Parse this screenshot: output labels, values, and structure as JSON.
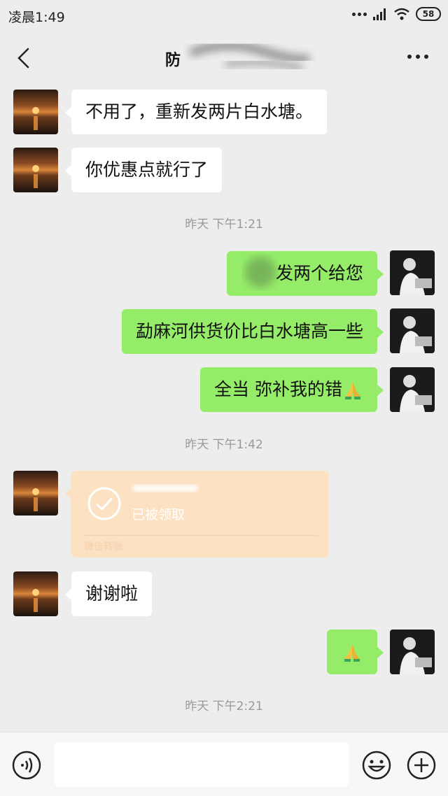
{
  "status": {
    "time": "凌晨1:49",
    "battery": "58"
  },
  "header": {
    "title": "防"
  },
  "messages": {
    "m1": "不用了，重新发两片白水塘。",
    "m2": "你优惠点就行了",
    "ts1": "昨天 下午1:21",
    "m3": "发两个给您",
    "m4": "勐麻河供货价比白水塘高一些",
    "m5": "全当 弥补我的错",
    "ts2": "昨天 下午1:42",
    "transfer_status": "已被领取",
    "transfer_label": "微信转账",
    "m6": "谢谢啦",
    "ts3": "昨天 下午2:21"
  },
  "input": {
    "value": "",
    "placeholder": ""
  },
  "icons": {
    "back": "back-chevron-icon",
    "more": "more-dots-icon",
    "voice": "voice-icon",
    "emoji": "emoji-icon",
    "plus": "plus-icon",
    "check": "check-circle-icon",
    "folded_hands": "folded-hands-emoji"
  },
  "colors": {
    "background": "#ededed",
    "sent_bubble": "#95ec69",
    "received_bubble": "#ffffff",
    "transfer": "#fde1c3"
  }
}
